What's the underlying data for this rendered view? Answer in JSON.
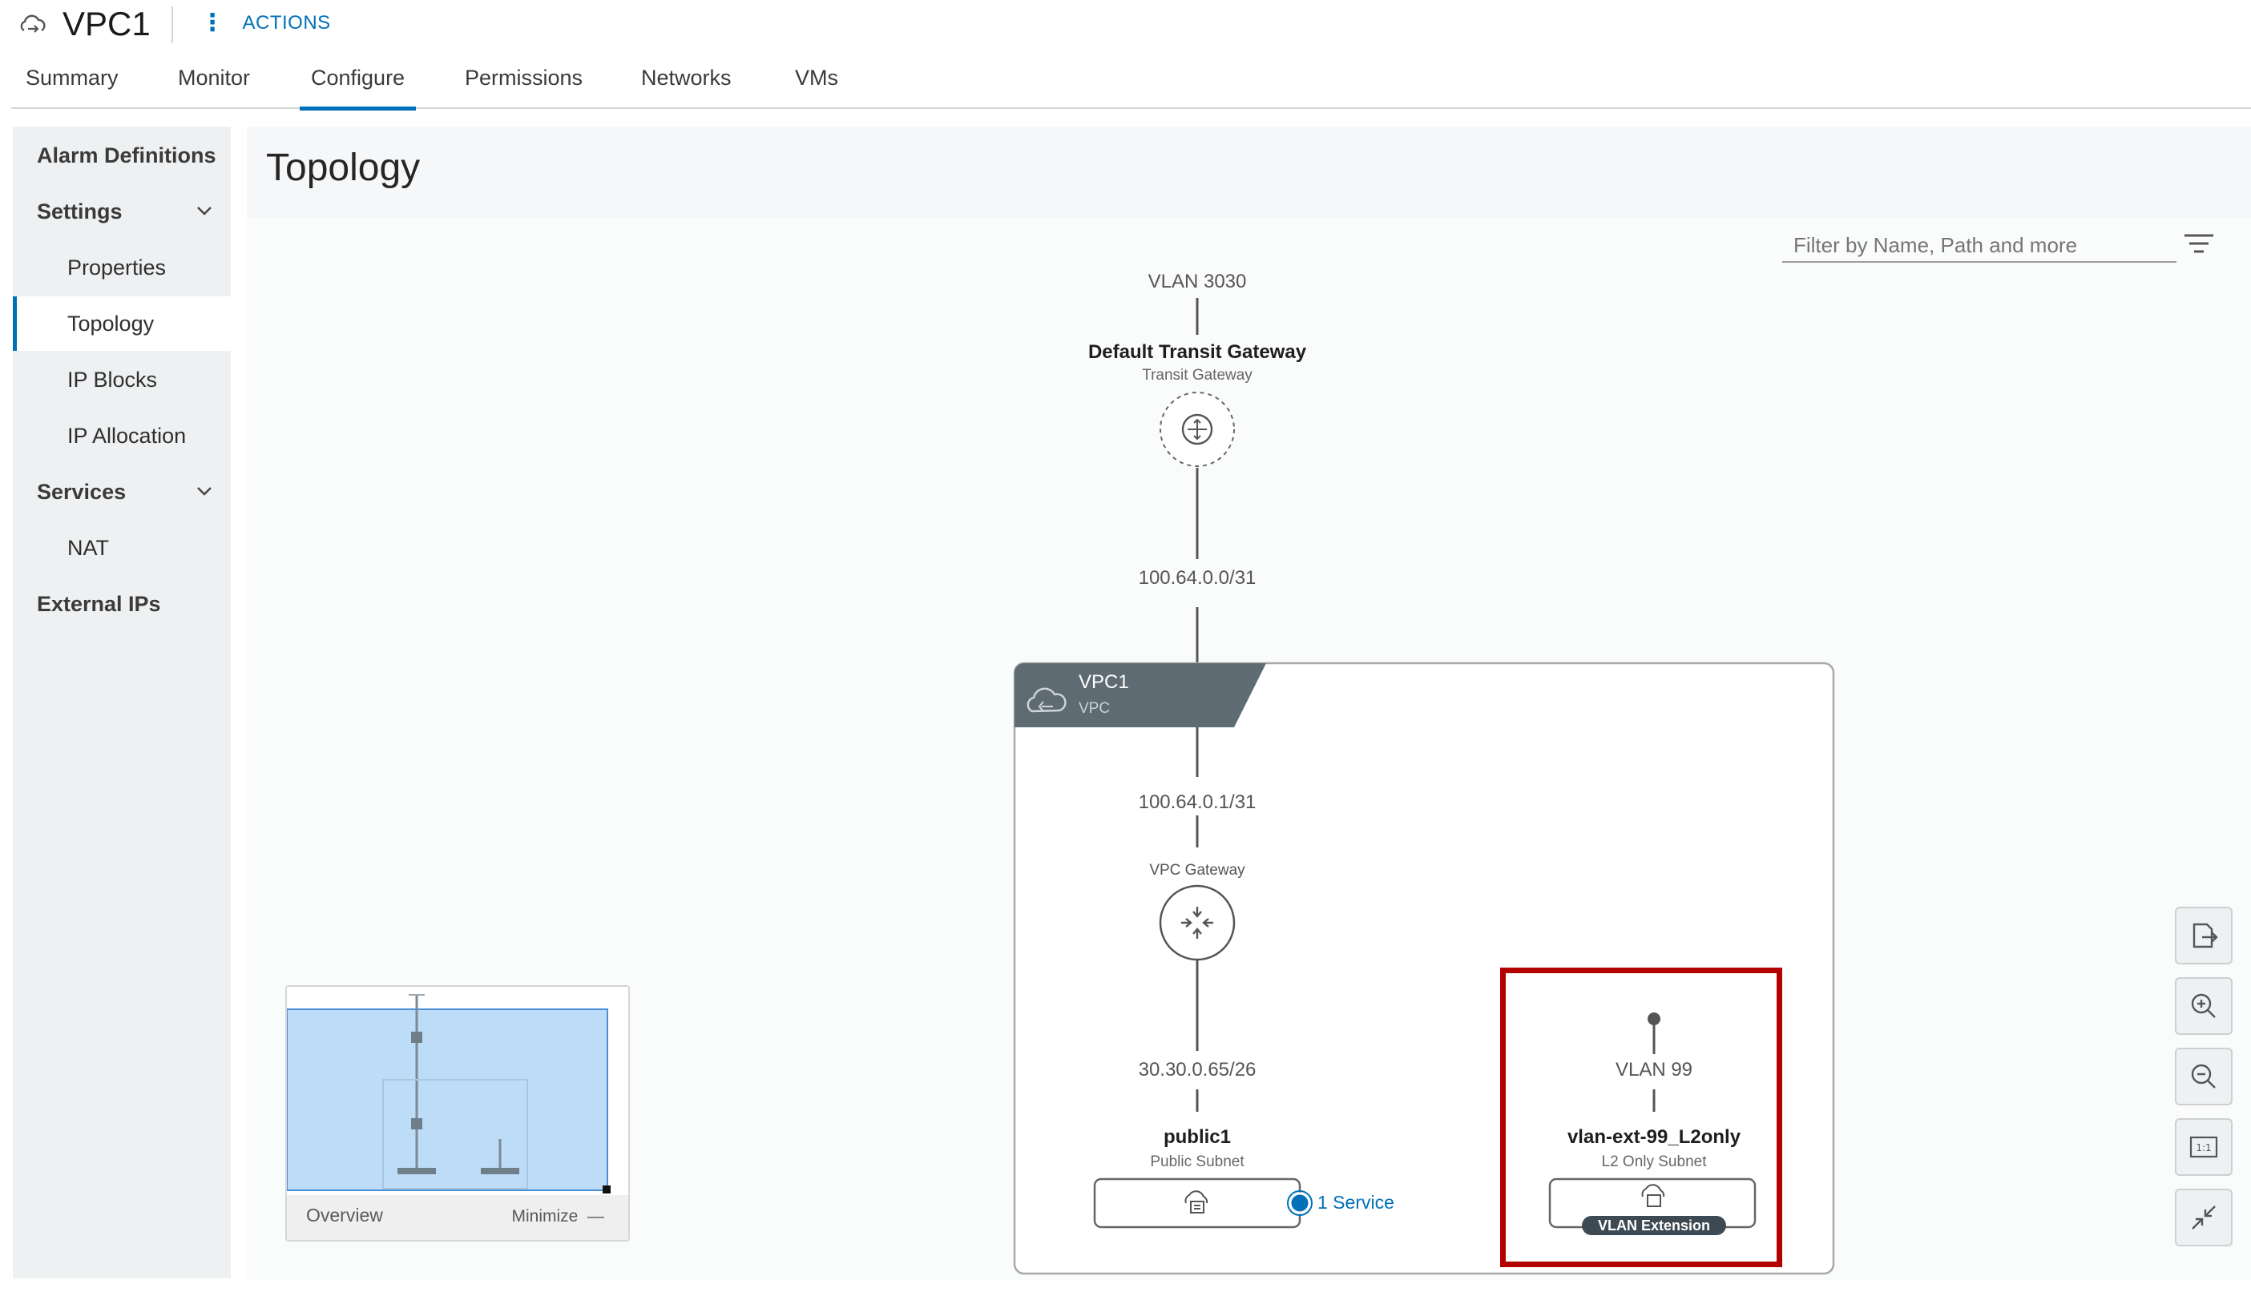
{
  "header": {
    "title": "VPC1",
    "actions_label": "ACTIONS",
    "icon": "vpc-cloud-icon"
  },
  "tabs": [
    {
      "label": "Summary"
    },
    {
      "label": "Monitor"
    },
    {
      "label": "Configure",
      "active": true
    },
    {
      "label": "Permissions"
    },
    {
      "label": "Networks"
    },
    {
      "label": "VMs"
    }
  ],
  "sidebar": {
    "items": [
      {
        "label": "Alarm Definitions"
      },
      {
        "label": "Settings"
      },
      {
        "label": "Properties"
      },
      {
        "label": "Topology",
        "selected": true
      },
      {
        "label": "IP Blocks"
      },
      {
        "label": "IP Allocation"
      },
      {
        "label": "Services"
      },
      {
        "label": "NAT"
      },
      {
        "label": "External IPs"
      }
    ]
  },
  "main": {
    "title": "Topology",
    "filter_placeholder": "Filter by Name, Path and more"
  },
  "topology": {
    "vlan_top": "VLAN 3030",
    "transit_gateway_name": "Default Transit Gateway",
    "transit_gateway_type": "Transit Gateway",
    "link_transit": "100.64.0.0/31",
    "vpc_name": "VPC1",
    "vpc_type": "VPC",
    "link_vpc": "100.64.0.1/31",
    "vpc_gateway_label": "VPC Gateway",
    "public_subnet_cidr": "30.30.0.65/26",
    "public_subnet_name": "public1",
    "public_subnet_type": "Public Subnet",
    "service_count": "1 Service",
    "vlan_ext": "VLAN 99",
    "l2_subnet_name": "vlan-ext-99_L2only",
    "l2_subnet_type": "L2 Only Subnet",
    "vlan_extension_badge": "VLAN Extension"
  },
  "overview": {
    "label": "Overview",
    "minimize_label": "Minimize"
  },
  "colors": {
    "accent": "#0070b8",
    "highlight": "#b30000",
    "vpc_header": "#5f6b73"
  }
}
